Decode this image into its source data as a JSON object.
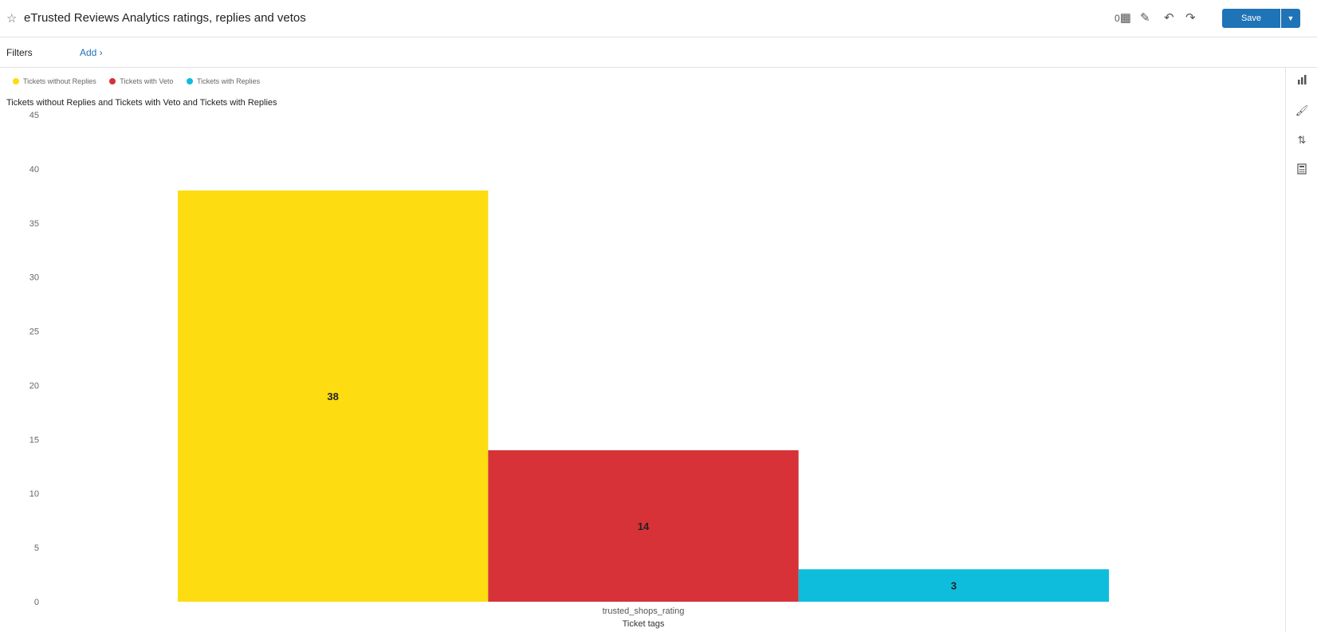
{
  "header": {
    "title": "eTrusted Reviews Analytics ratings, replies and vetos",
    "counter": "0",
    "save_label": "Save",
    "icons": [
      "star-icon",
      "layout-icon",
      "edit-icon",
      "undo-icon",
      "redo-icon",
      "chevron-down-icon"
    ]
  },
  "filters": {
    "label": "Filters",
    "add_label": "Add ›"
  },
  "sidebar_icons": [
    "bar-chart-icon",
    "brush-icon",
    "sort-icon",
    "calculator-icon"
  ],
  "legend": [
    {
      "label": "Tickets without Replies",
      "color": "#fddc12"
    },
    {
      "label": "Tickets with Veto",
      "color": "#d63238"
    },
    {
      "label": "Tickets with Replies",
      "color": "#0ebddc"
    }
  ],
  "chart_data": {
    "type": "bar",
    "title": "Tickets without Replies and Tickets with Veto and Tickets with Replies",
    "categories": [
      "trusted_shops_rating"
    ],
    "xlabel": "Ticket tags",
    "ylabel": "",
    "ylim": [
      0,
      45
    ],
    "yticks": [
      "0",
      "5",
      "10",
      "15",
      "20",
      "25",
      "30",
      "35",
      "40",
      "45"
    ],
    "grid": false,
    "legend_position": "top-left",
    "series": [
      {
        "name": "Tickets without Replies",
        "values": [
          38
        ],
        "color": "#fddc12"
      },
      {
        "name": "Tickets with Veto",
        "values": [
          14
        ],
        "color": "#d63238"
      },
      {
        "name": "Tickets with Replies",
        "values": [
          3
        ],
        "color": "#0ebddc"
      }
    ]
  }
}
